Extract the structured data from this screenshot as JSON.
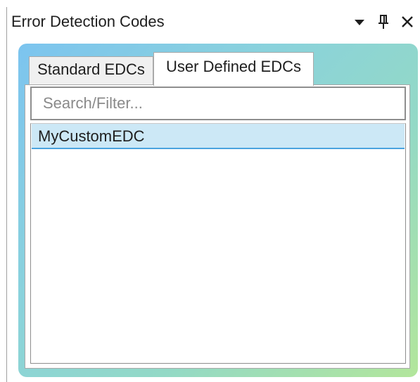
{
  "window": {
    "title": "Error Detection Codes",
    "buttons": {
      "dropdown_icon": "triangle-down",
      "pin_icon": "pushpin",
      "close_icon": "close-x"
    }
  },
  "tabs": [
    {
      "label": "Standard EDCs",
      "selected": false
    },
    {
      "label": "User Defined EDCs",
      "selected": true
    }
  ],
  "search": {
    "value": "",
    "placeholder": "Search/Filter..."
  },
  "list": {
    "items": [
      {
        "label": "MyCustomEDC",
        "selected": true
      }
    ]
  },
  "colors": {
    "selection_background": "#cce8f6",
    "selection_underline": "#4aa3df",
    "frame_gradient_start": "#7cc4ef",
    "frame_gradient_end": "#b3e69b"
  }
}
